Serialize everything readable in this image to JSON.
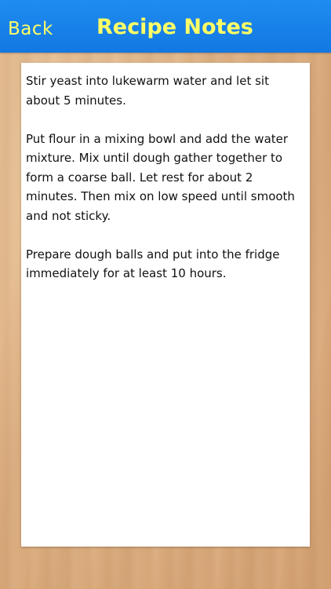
{
  "nav": {
    "back_label": "Back",
    "title": "Recipe Notes"
  },
  "notes": {
    "paragraphs": [
      "Stir yeast into lukewarm water and let sit about 5 minutes.",
      "Put flour in a mixing bowl and add the water mixture.  Mix until dough gather together to form a coarse ball.  Let rest for about 2 minutes.  Then mix on low speed until smooth and not sticky.",
      "Prepare dough balls and put into the fridge immediately for at least 10 hours."
    ]
  },
  "colors": {
    "nav_background": "#1378e2",
    "nav_text": "#ffff66",
    "paper": "#ffffff",
    "wood": "#dcae80"
  }
}
